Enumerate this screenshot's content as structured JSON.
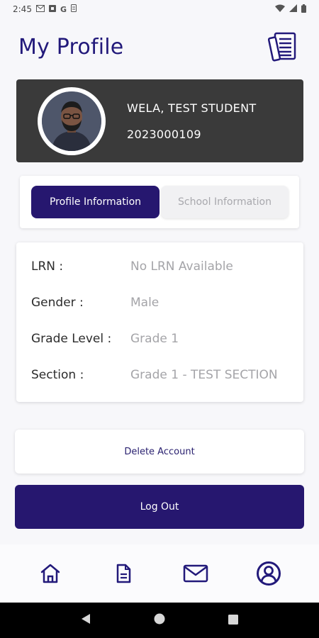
{
  "status_bar": {
    "time": "2:45",
    "left_icons": [
      "gmail-icon",
      "notification-icon",
      "google-icon",
      "storage-icon"
    ],
    "right_icons": [
      "wifi-icon",
      "cellular-icon",
      "battery-icon"
    ]
  },
  "header": {
    "title": "My Profile",
    "action_icon": "document-list-icon"
  },
  "student": {
    "name": "WELA, TEST STUDENT",
    "id": "2023000109",
    "avatar_icon": "student-avatar"
  },
  "tabs": [
    {
      "label": "Profile Information",
      "active": true
    },
    {
      "label": "School Information",
      "active": false
    }
  ],
  "profile_info": {
    "rows": [
      {
        "label": "LRN :",
        "value": "No LRN Available"
      },
      {
        "label": "Gender :",
        "value": "Male"
      },
      {
        "label": "Grade Level :",
        "value": "Grade 1"
      },
      {
        "label": "Section :",
        "value": "Grade 1 - TEST SECTION"
      }
    ]
  },
  "actions": {
    "delete_label": "Delete Account",
    "logout_label": "Log Out"
  },
  "bottom_nav": {
    "items": [
      {
        "name": "home-icon"
      },
      {
        "name": "document-icon"
      },
      {
        "name": "mail-icon"
      },
      {
        "name": "profile-icon",
        "active": true
      }
    ]
  },
  "colors": {
    "primary": "#26176f",
    "title": "#22197a",
    "card_dark": "#3a3a3a",
    "muted_text": "#a4a4a8"
  }
}
